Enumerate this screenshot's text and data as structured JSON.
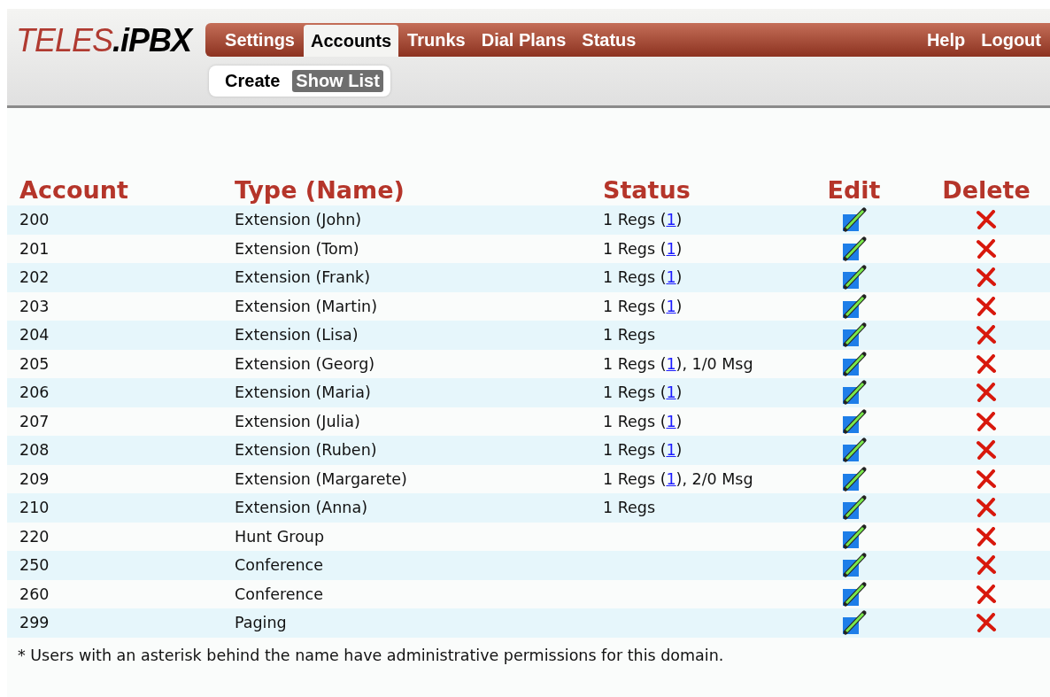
{
  "logo": {
    "brand": "TELES",
    "product": ".iPBX"
  },
  "nav": [
    {
      "label": "Settings",
      "selected": false
    },
    {
      "label": "Accounts",
      "selected": true
    },
    {
      "label": "Trunks",
      "selected": false
    },
    {
      "label": "Dial Plans",
      "selected": false
    },
    {
      "label": "Status",
      "selected": false
    }
  ],
  "nav_right": [
    "Help",
    "Logout"
  ],
  "subnav": [
    {
      "label": "Create",
      "selected": false
    },
    {
      "label": "Show List",
      "selected": true
    }
  ],
  "table": {
    "columns": [
      "Account",
      "Type (Name)",
      "Status",
      "Edit",
      "Delete"
    ],
    "rows": [
      {
        "account": "200",
        "type": "Extension (John)",
        "status": {
          "before": "1 Regs (",
          "link": "1",
          "after": ")"
        }
      },
      {
        "account": "201",
        "type": "Extension (Tom)",
        "status": {
          "before": "1 Regs (",
          "link": "1",
          "after": ")"
        }
      },
      {
        "account": "202",
        "type": "Extension (Frank)",
        "status": {
          "before": "1 Regs (",
          "link": "1",
          "after": ")"
        }
      },
      {
        "account": "203",
        "type": "Extension (Martin)",
        "status": {
          "before": "1 Regs (",
          "link": "1",
          "after": ")"
        }
      },
      {
        "account": "204",
        "type": "Extension (Lisa)",
        "status": {
          "before": "1 Regs"
        }
      },
      {
        "account": "205",
        "type": "Extension (Georg)",
        "status": {
          "before": "1 Regs (",
          "link": "1",
          "after": "), 1/0 Msg"
        }
      },
      {
        "account": "206",
        "type": "Extension (Maria)",
        "status": {
          "before": "1 Regs (",
          "link": "1",
          "after": ")"
        }
      },
      {
        "account": "207",
        "type": "Extension (Julia)",
        "status": {
          "before": "1 Regs (",
          "link": "1",
          "after": ")"
        }
      },
      {
        "account": "208",
        "type": "Extension (Ruben)",
        "status": {
          "before": "1 Regs (",
          "link": "1",
          "after": ")"
        }
      },
      {
        "account": "209",
        "type": "Extension (Margarete)",
        "status": {
          "before": "1 Regs (",
          "link": "1",
          "after": "), 2/0 Msg"
        }
      },
      {
        "account": "210",
        "type": "Extension (Anna)",
        "status": {
          "before": "1 Regs"
        }
      },
      {
        "account": "220",
        "type": "Hunt Group"
      },
      {
        "account": "250",
        "type": "Conference"
      },
      {
        "account": "260",
        "type": "Conference"
      },
      {
        "account": "299",
        "type": "Paging"
      }
    ]
  },
  "footnote": "* Users with an asterisk behind the name have administrative permissions for this domain."
}
